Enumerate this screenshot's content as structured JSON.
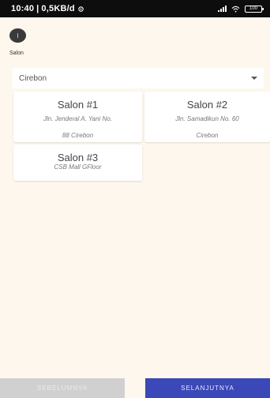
{
  "status_bar": {
    "time": "10:40",
    "speed": "0,5KB/d",
    "battery": "100"
  },
  "header": {
    "title": "Salon"
  },
  "city_select": {
    "value": "Cirebon"
  },
  "salons": [
    {
      "name": "Salon #1",
      "address_line1": "Jln. Jenderal A. Yani No.",
      "address_line2": "88 Cirebon"
    },
    {
      "name": "Salon #2",
      "address_line1": "Jln. Samadikun No. 60",
      "address_line2": "Cirebon"
    },
    {
      "name": "Salon #3",
      "address_line1": "CSB Mall GFloor",
      "address_line2": ""
    }
  ],
  "footer": {
    "prev_label": "SEBELUMNYA",
    "next_label": "SELANJUTNYA"
  },
  "colors": {
    "background": "#fdf7ee",
    "primary": "#3b48b8",
    "disabled": "#d0d0d0"
  }
}
